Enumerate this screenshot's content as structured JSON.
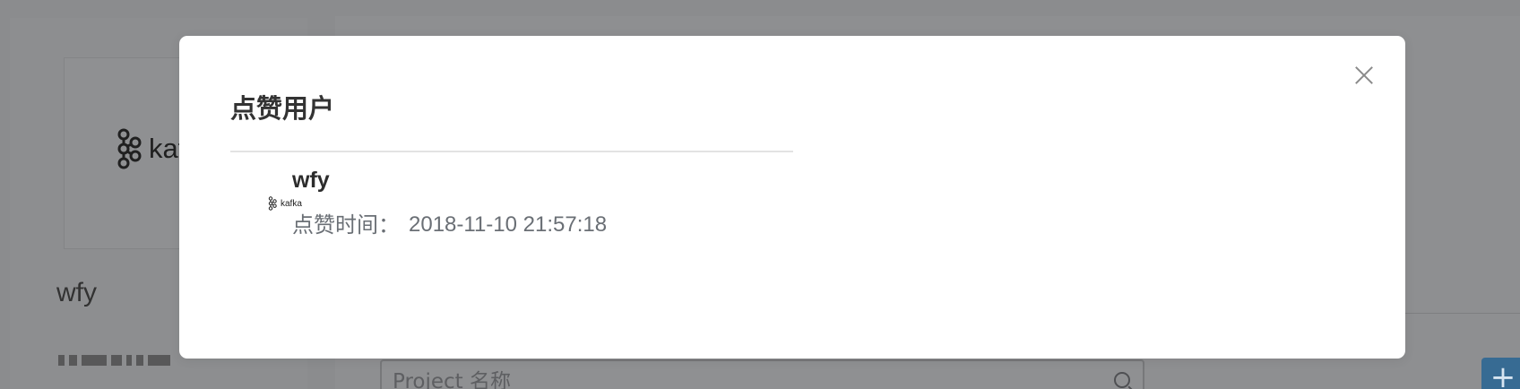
{
  "background": {
    "logo_text": "kaf",
    "profile_name": "wfy",
    "search_placeholder": "Project 名称",
    "add_button_label": "+"
  },
  "modal": {
    "title": "点赞用户",
    "close_icon": "close-icon",
    "items": [
      {
        "avatar_text": "kafka",
        "username": "wfy",
        "time_label": "点赞时间：",
        "time_value": "2018-11-10 21:57:18"
      }
    ]
  },
  "colors": {
    "overlay": "#8b8c8e",
    "modal_bg": "#ffffff",
    "primary_blue": "#376b93",
    "title_text": "#333333",
    "secondary_text": "#6a6f75"
  }
}
